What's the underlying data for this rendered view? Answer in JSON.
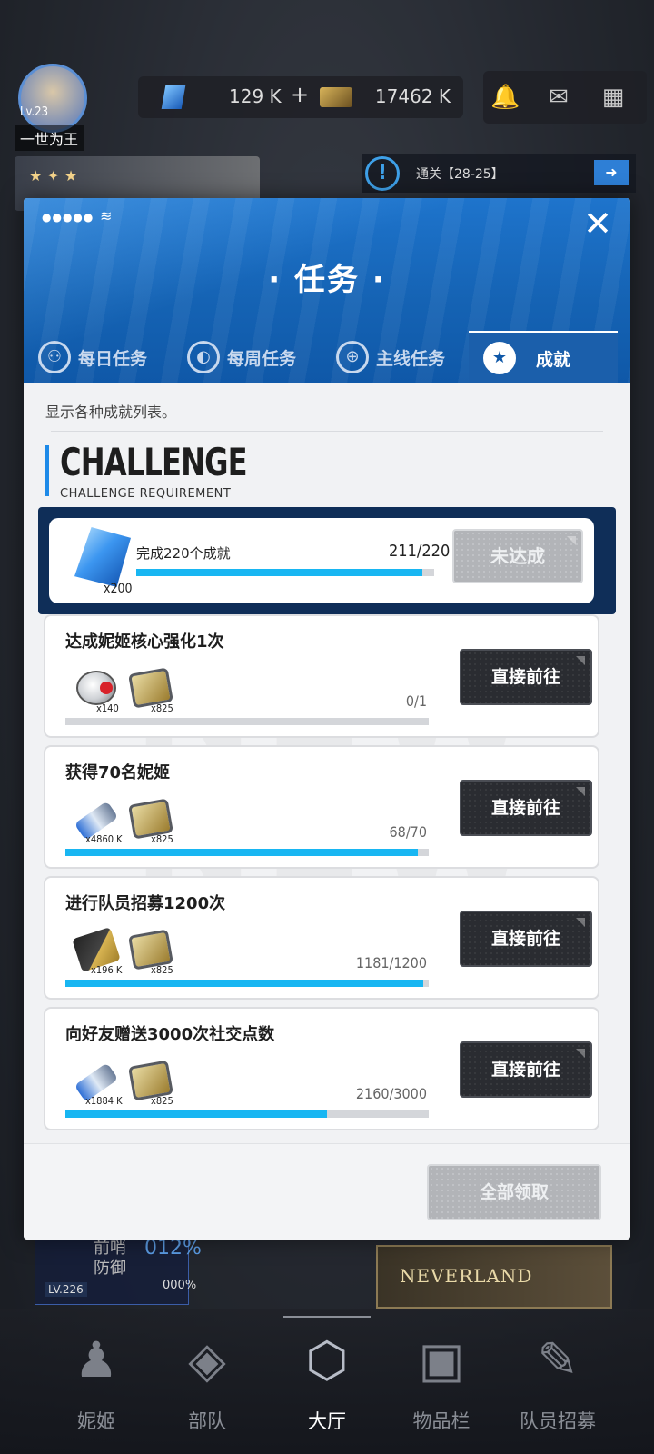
{
  "top_bar": {
    "level": "Lv.23",
    "username": "一世为王",
    "gems": "129 K",
    "gems_plus": "+",
    "credits": "17462 K"
  },
  "quest_hint": {
    "icon": "alert-icon",
    "text": "通关【28-25】"
  },
  "modal": {
    "signal": "●●●●●",
    "title": "· 任务 ·",
    "close_glyph": "✕",
    "tabs": [
      {
        "label": "每日任务",
        "icon": "daily-icon",
        "active": false
      },
      {
        "label": "每周任务",
        "icon": "weekly-icon",
        "active": false
      },
      {
        "label": "主线任务",
        "icon": "globe-icon",
        "active": false
      },
      {
        "label": "成就",
        "icon": "star-icon",
        "active": true
      }
    ],
    "description": "显示各种成就列表。",
    "section_title": "CHALLENGE",
    "section_subtitle": "CHALLENGE REQUIREMENT",
    "challenge": {
      "task": "完成220个成就",
      "progress_text": "211/220",
      "progress": 0.959,
      "reward_qty": "x200",
      "button": "未达成"
    },
    "tasks": [
      {
        "title": "达成妮姬核心强化1次",
        "rewards": [
          {
            "icon": "core-orb-icon",
            "qty": "x140"
          },
          {
            "icon": "chip-icon",
            "qty": "x825"
          }
        ],
        "progress_text": "0/1",
        "progress": 0.0,
        "button": "直接前往"
      },
      {
        "title": "获得70名妮姬",
        "rewards": [
          {
            "icon": "drive-icon",
            "qty": "x4860 K"
          },
          {
            "icon": "chip-icon",
            "qty": "x825"
          }
        ],
        "progress_text": "68/70",
        "progress": 0.971,
        "button": "直接前往"
      },
      {
        "title": "进行队员招募1200次",
        "rewards": [
          {
            "icon": "credit-card-icon",
            "qty": "x196 K"
          },
          {
            "icon": "chip-icon",
            "qty": "x825"
          }
        ],
        "progress_text": "1181/1200",
        "progress": 0.984,
        "button": "直接前往"
      },
      {
        "title": "向好友赠送3000次社交点数",
        "rewards": [
          {
            "icon": "drive-icon",
            "qty": "x1884 K"
          },
          {
            "icon": "chip-icon",
            "qty": "x825"
          }
        ],
        "progress_text": "2160/3000",
        "progress": 0.72,
        "button": "直接前往"
      }
    ],
    "claim_all": "全部领取",
    "colors": {
      "header_blue": "#1563b4",
      "progress_cyan": "#18b6f2",
      "challenge_navy": "#0f2e58",
      "button_dark": "#2a2c31",
      "button_disabled": "#b2b4b8"
    }
  },
  "background": {
    "status_level": "LV.226",
    "status_text": "前哨\n防御",
    "status_pct": "012%",
    "status_pct2": "000%",
    "neverland": "NEVERLAND"
  },
  "bottom_nav": [
    {
      "label": "妮姬",
      "icon": "nikke-icon",
      "active": false
    },
    {
      "label": "部队",
      "icon": "squad-icon",
      "active": false
    },
    {
      "label": "大厅",
      "icon": "lobby-icon",
      "active": true
    },
    {
      "label": "物品栏",
      "icon": "inventory-icon",
      "active": false
    },
    {
      "label": "队员招募",
      "icon": "recruit-icon",
      "active": false
    }
  ]
}
